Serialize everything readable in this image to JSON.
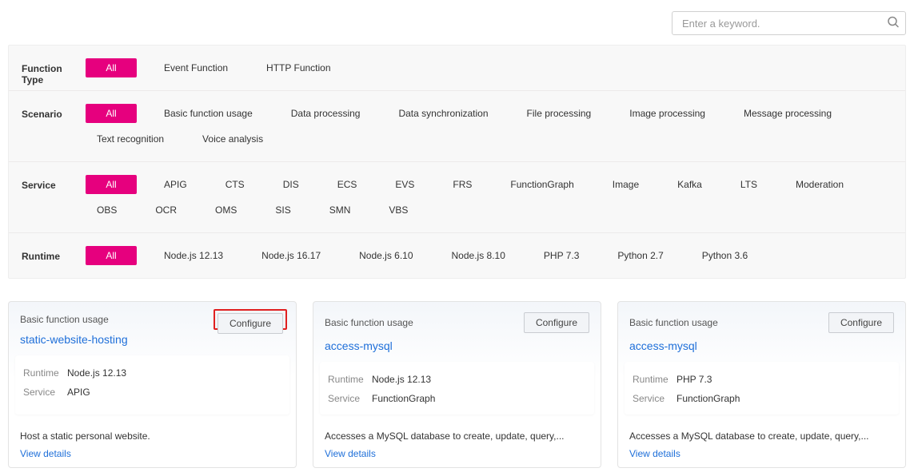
{
  "search": {
    "placeholder": "Enter a keyword."
  },
  "filters": {
    "functionType": {
      "label": "Function Type",
      "options": [
        "All",
        "Event Function",
        "HTTP Function"
      ],
      "active": 0
    },
    "scenario": {
      "label": "Scenario",
      "options": [
        "All",
        "Basic function usage",
        "Data processing",
        "Data synchronization",
        "File processing",
        "Image processing",
        "Message processing",
        "Text recognition",
        "Voice analysis"
      ],
      "active": 0
    },
    "service": {
      "label": "Service",
      "options": [
        "All",
        "APIG",
        "CTS",
        "DIS",
        "ECS",
        "EVS",
        "FRS",
        "FunctionGraph",
        "Image",
        "Kafka",
        "LTS",
        "Moderation",
        "OBS",
        "OCR",
        "OMS",
        "SIS",
        "SMN",
        "VBS"
      ],
      "active": 0
    },
    "runtime": {
      "label": "Runtime",
      "options": [
        "All",
        "Node.js 12.13",
        "Node.js 16.17",
        "Node.js 6.10",
        "Node.js 8.10",
        "PHP 7.3",
        "Python 2.7",
        "Python 3.6"
      ],
      "active": 0
    }
  },
  "cards": [
    {
      "category": "Basic function usage",
      "title": "static-website-hosting",
      "runtimeLabel": "Runtime",
      "runtimeValue": "Node.js 12.13",
      "serviceLabel": "Service",
      "serviceValue": "APIG",
      "description": "Host a static personal website.",
      "configureLabel": "Configure",
      "viewDetails": "View details",
      "highlighted": true
    },
    {
      "category": "Basic function usage",
      "title": "access-mysql",
      "runtimeLabel": "Runtime",
      "runtimeValue": "Node.js 12.13",
      "serviceLabel": "Service",
      "serviceValue": "FunctionGraph",
      "description": "Accesses a MySQL database to create, update, query,...",
      "configureLabel": "Configure",
      "viewDetails": "View details",
      "highlighted": false
    },
    {
      "category": "Basic function usage",
      "title": "access-mysql",
      "runtimeLabel": "Runtime",
      "runtimeValue": "PHP 7.3",
      "serviceLabel": "Service",
      "serviceValue": "FunctionGraph",
      "description": "Accesses a MySQL database to create, update, query,...",
      "configureLabel": "Configure",
      "viewDetails": "View details",
      "highlighted": false
    }
  ]
}
